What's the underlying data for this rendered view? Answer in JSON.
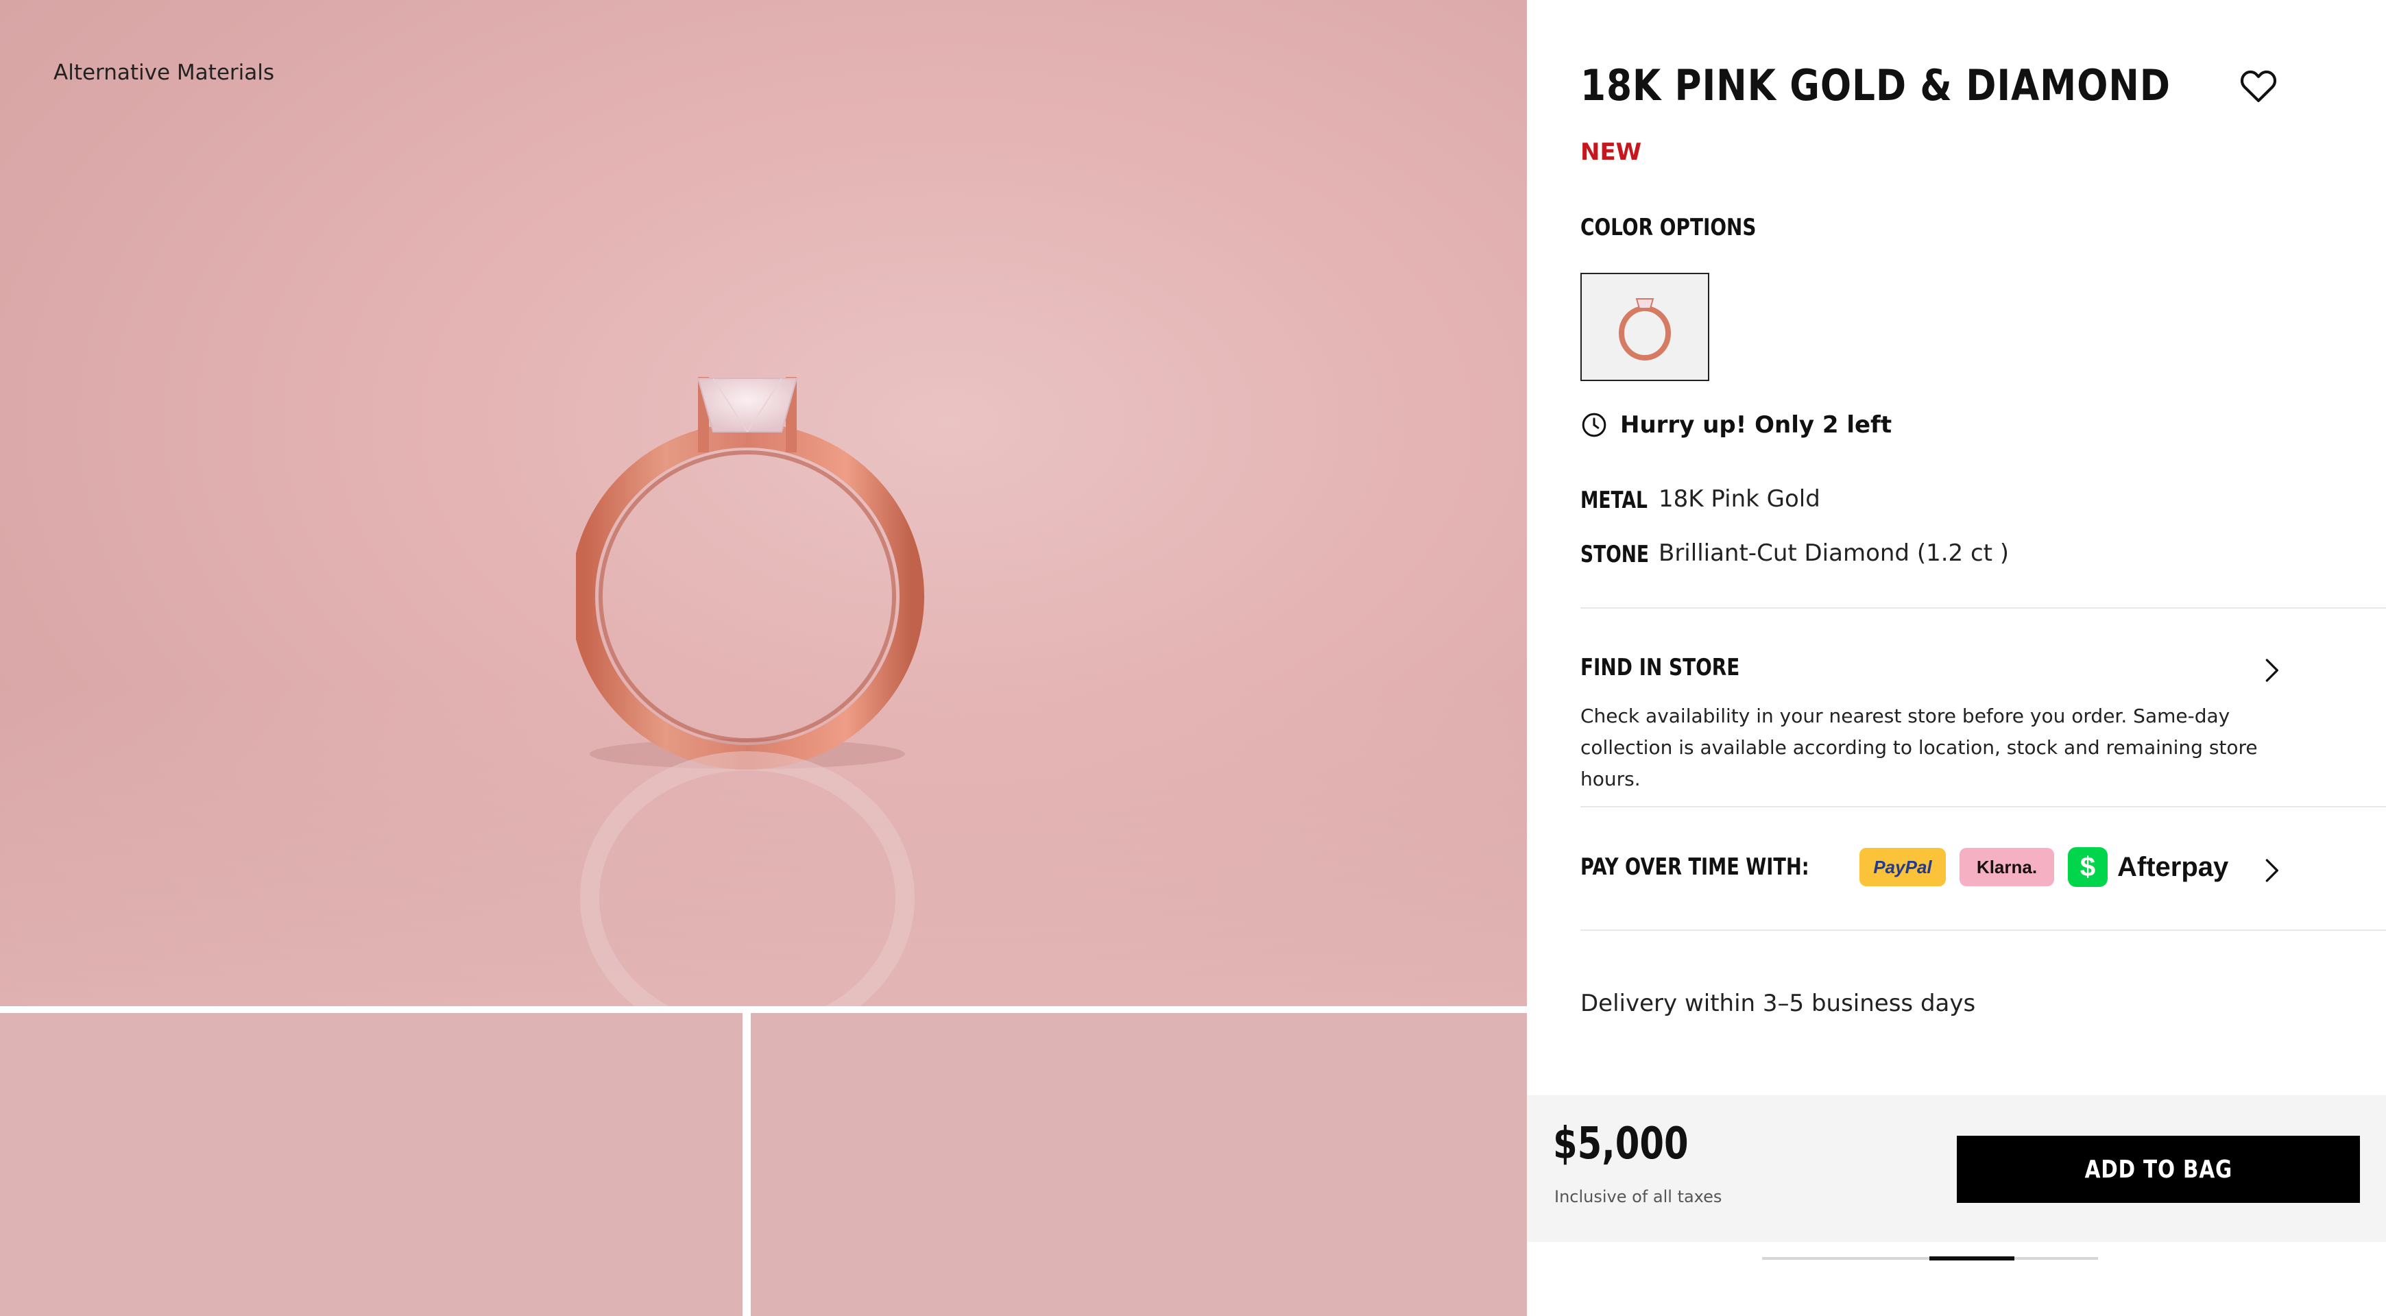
{
  "breadcrumb": "Alternative Materials",
  "product": {
    "title": "18K PINK GOLD & DIAMOND",
    "badge": "NEW",
    "color_options_label": "COLOR OPTIONS",
    "stock_message": "Hurry up! Only 2 left",
    "specs": [
      {
        "key": "METAL",
        "value": "18K Pink Gold"
      },
      {
        "key": "STONE",
        "value": "Brilliant-Cut Diamond (1.2 ct )"
      }
    ]
  },
  "find_in_store": {
    "label": "FIND IN STORE",
    "description": "Check availability in your nearest store before you order. Same-day collection is available according to location, stock and remaining store hours."
  },
  "payment": {
    "label": "PAY OVER TIME WITH:",
    "providers": [
      "PayPal",
      "Klarna.",
      "Afterpay"
    ],
    "cash_symbol": "$"
  },
  "delivery": "Delivery within 3–5 business days",
  "checkout": {
    "price": "$5,000",
    "tax_note": "Inclusive of all taxes",
    "add_to_bag": "ADD TO BAG"
  },
  "icons": {
    "heart": "heart-icon",
    "clock": "clock-icon",
    "chevron": "chevron-right-icon"
  },
  "colors": {
    "accent_new": "#c8161d",
    "button_bg": "#000000",
    "hero_bg": "#e4b3b3",
    "ring_gold": "#d9806d"
  }
}
